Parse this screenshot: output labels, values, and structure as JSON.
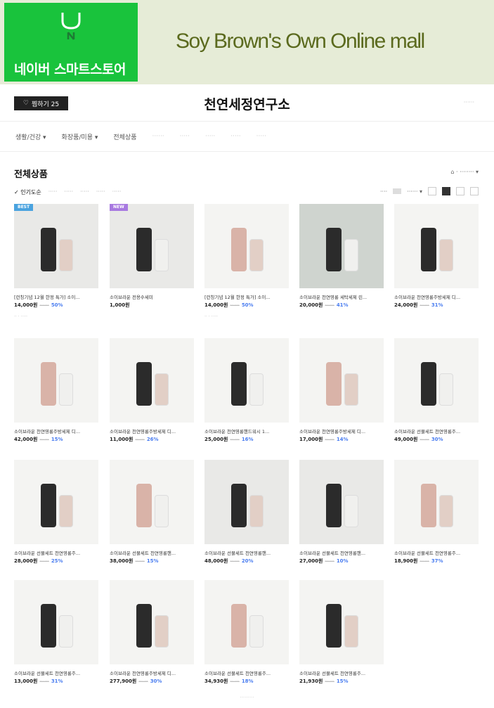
{
  "banner": {
    "naver_label": "네이버 스마트스토어",
    "mall_title": "Soy Brown's Own Online mall",
    "brand_color": "#19c33c"
  },
  "store": {
    "zzim_label": "찜하기 25",
    "name": "천연세정연구소"
  },
  "nav": {
    "items": [
      "생활/건강",
      "화장품/미용",
      "전체상품"
    ]
  },
  "section": {
    "title": "전체상품",
    "sort": [
      "인기도순"
    ]
  },
  "products": [
    {
      "name": "[런칭기념 12월 한정 특가] 소이...",
      "price": "14,000원",
      "discount": "50%",
      "badge": "BEST",
      "review": ""
    },
    {
      "name": "소이브라운 전용수세미",
      "price": "1,000원",
      "discount": "",
      "badge": "NEW",
      "review": ""
    },
    {
      "name": "[런칭기념 12월 한정 특가] 소이...",
      "price": "14,000원",
      "discount": "50%",
      "badge": "",
      "review": ""
    },
    {
      "name": "소이브라운 천연영롱 세탁세제 린...",
      "price": "20,000원",
      "discount": "41%",
      "badge": "",
      "review": ""
    },
    {
      "name": "소이브라운 천연영롱주방세제 디...",
      "price": "24,000원",
      "discount": "31%",
      "badge": "",
      "review": ""
    },
    {
      "name": "소이브라운 천연영롱주방세제 디...",
      "price": "42,000원",
      "discount": "15%",
      "badge": "",
      "review": ""
    },
    {
      "name": "소이브라운 천연영롱주방세제 디...",
      "price": "11,000원",
      "discount": "26%",
      "badge": "",
      "review": ""
    },
    {
      "name": "소이브라운 천연영롱핸드워시 1...",
      "price": "25,000원",
      "discount": "16%",
      "badge": "",
      "review": ""
    },
    {
      "name": "소이브라운 천연영롱주방세제 디...",
      "price": "17,000원",
      "discount": "14%",
      "badge": "",
      "review": ""
    },
    {
      "name": "소이브라운 선물세트 천연영롱주...",
      "price": "49,000원",
      "discount": "30%",
      "badge": "",
      "review": ""
    },
    {
      "name": "소이브라운 선물세트 천연영롱주...",
      "price": "28,000원",
      "discount": "25%",
      "badge": "",
      "review": ""
    },
    {
      "name": "소이브라운 선물세트 천연영롱핸...",
      "price": "38,000원",
      "discount": "15%",
      "badge": "",
      "review": ""
    },
    {
      "name": "소이브라운 선물세트 천연영롱핸...",
      "price": "48,000원",
      "discount": "20%",
      "badge": "",
      "review": ""
    },
    {
      "name": "소이브라운 선물세트 천연영롱핸...",
      "price": "27,000원",
      "discount": "10%",
      "badge": "",
      "review": ""
    },
    {
      "name": "소이브라운 선물세트 천연영롱주...",
      "price": "18,900원",
      "discount": "37%",
      "badge": "",
      "review": ""
    },
    {
      "name": "소이브라운 선물세트 천연영롱주...",
      "price": "13,000원",
      "discount": "31%",
      "badge": "",
      "review": ""
    },
    {
      "name": "소이브라운 천연영롱주방세제 디...",
      "price": "277,900원",
      "discount": "30%",
      "badge": "",
      "review": ""
    },
    {
      "name": "소이브라운 선물세트 천연영롱주...",
      "price": "34,930원",
      "discount": "18%",
      "badge": "",
      "review": ""
    },
    {
      "name": "소이브라운 선물세트 천연영롱주...",
      "price": "21,930원",
      "discount": "15%",
      "badge": "",
      "review": ""
    }
  ]
}
